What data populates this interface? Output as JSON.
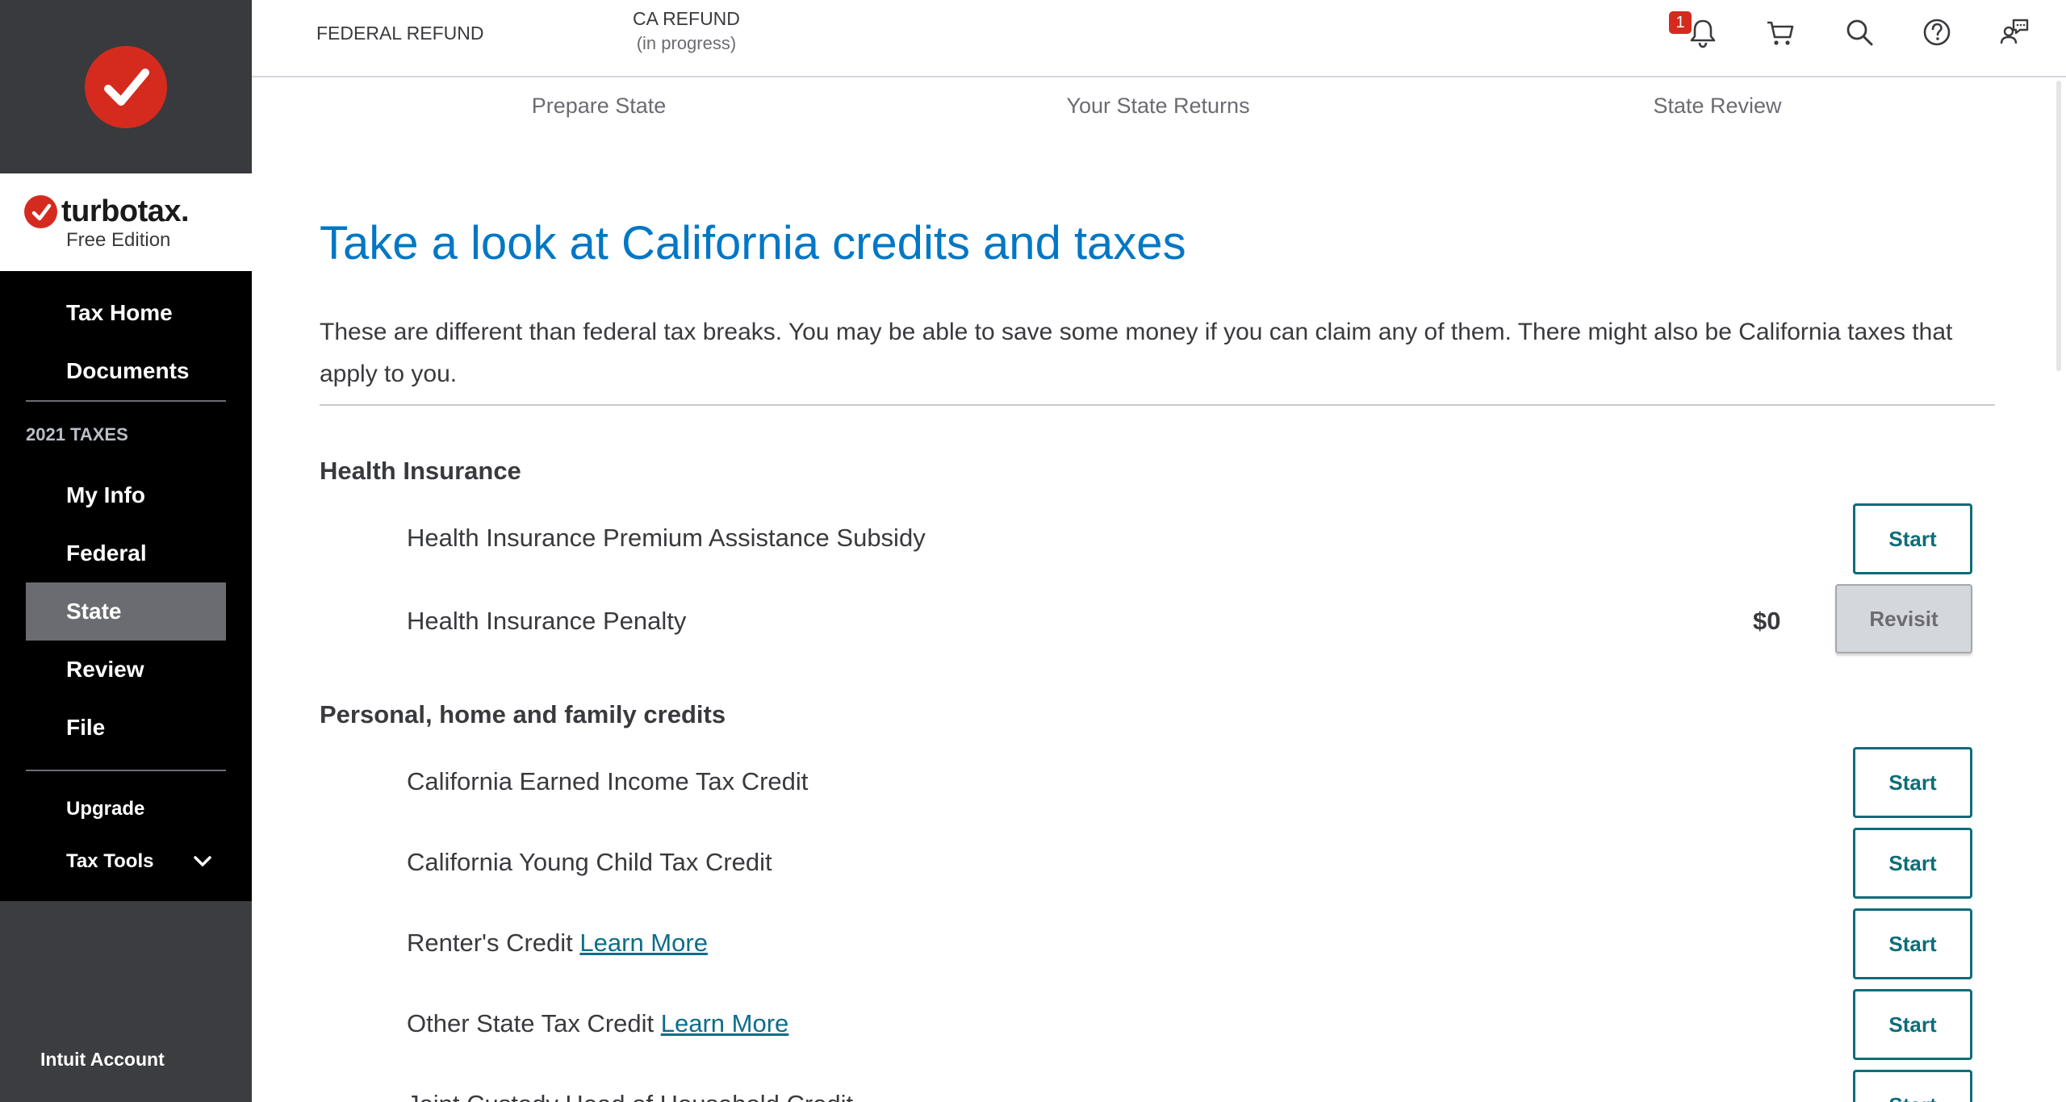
{
  "sidebar": {
    "brand_name": "turbotax.",
    "brand_edition": "Free Edition",
    "nav_top": [
      {
        "label": "Tax Home"
      },
      {
        "label": "Documents"
      }
    ],
    "section_label": "2021 TAXES",
    "nav_taxes": [
      {
        "label": "My Info",
        "active": false
      },
      {
        "label": "Federal",
        "active": false
      },
      {
        "label": "State",
        "active": true
      },
      {
        "label": "Review",
        "active": false
      },
      {
        "label": "File",
        "active": false
      }
    ],
    "upgrade_label": "Upgrade",
    "tax_tools_label": "Tax Tools",
    "footer_label": "Intuit Account"
  },
  "topbar": {
    "federal_refund_label": "FEDERAL REFUND",
    "ca_refund_label": "CA REFUND",
    "ca_refund_status": "(in progress)",
    "notification_count": "1"
  },
  "steps": [
    "Prepare State",
    "Your State Returns",
    "State Review"
  ],
  "main": {
    "title": "Take a look at California credits and taxes",
    "intro": "These are different than federal tax breaks. You may be able to save some money if you can claim any of them. There might also be California taxes that apply to you.",
    "sections": [
      {
        "heading": "Health Insurance",
        "rows": [
          {
            "label": "Health Insurance Premium Assistance Subsidy",
            "button": "Start"
          },
          {
            "label": "Health Insurance Penalty",
            "amount": "$0",
            "button": "Revisit"
          }
        ]
      },
      {
        "heading": "Personal, home and family credits",
        "rows": [
          {
            "label": "California Earned Income Tax Credit",
            "button": "Start"
          },
          {
            "label": "California Young Child Tax Credit",
            "button": "Start"
          },
          {
            "label": "Renter's Credit",
            "link": "Learn More",
            "button": "Start"
          },
          {
            "label": "Other State Tax Credit",
            "link": "Learn More",
            "button": "Start"
          },
          {
            "label": "Joint Custody Head of Household Credit",
            "button": "Start"
          }
        ]
      }
    ]
  },
  "colors": {
    "accent_blue": "#0077c5",
    "button_teal": "#0d6d78",
    "brand_red": "#d52b1e",
    "sidebar_dark": "#3c3d40",
    "nav_black": "#000000"
  }
}
